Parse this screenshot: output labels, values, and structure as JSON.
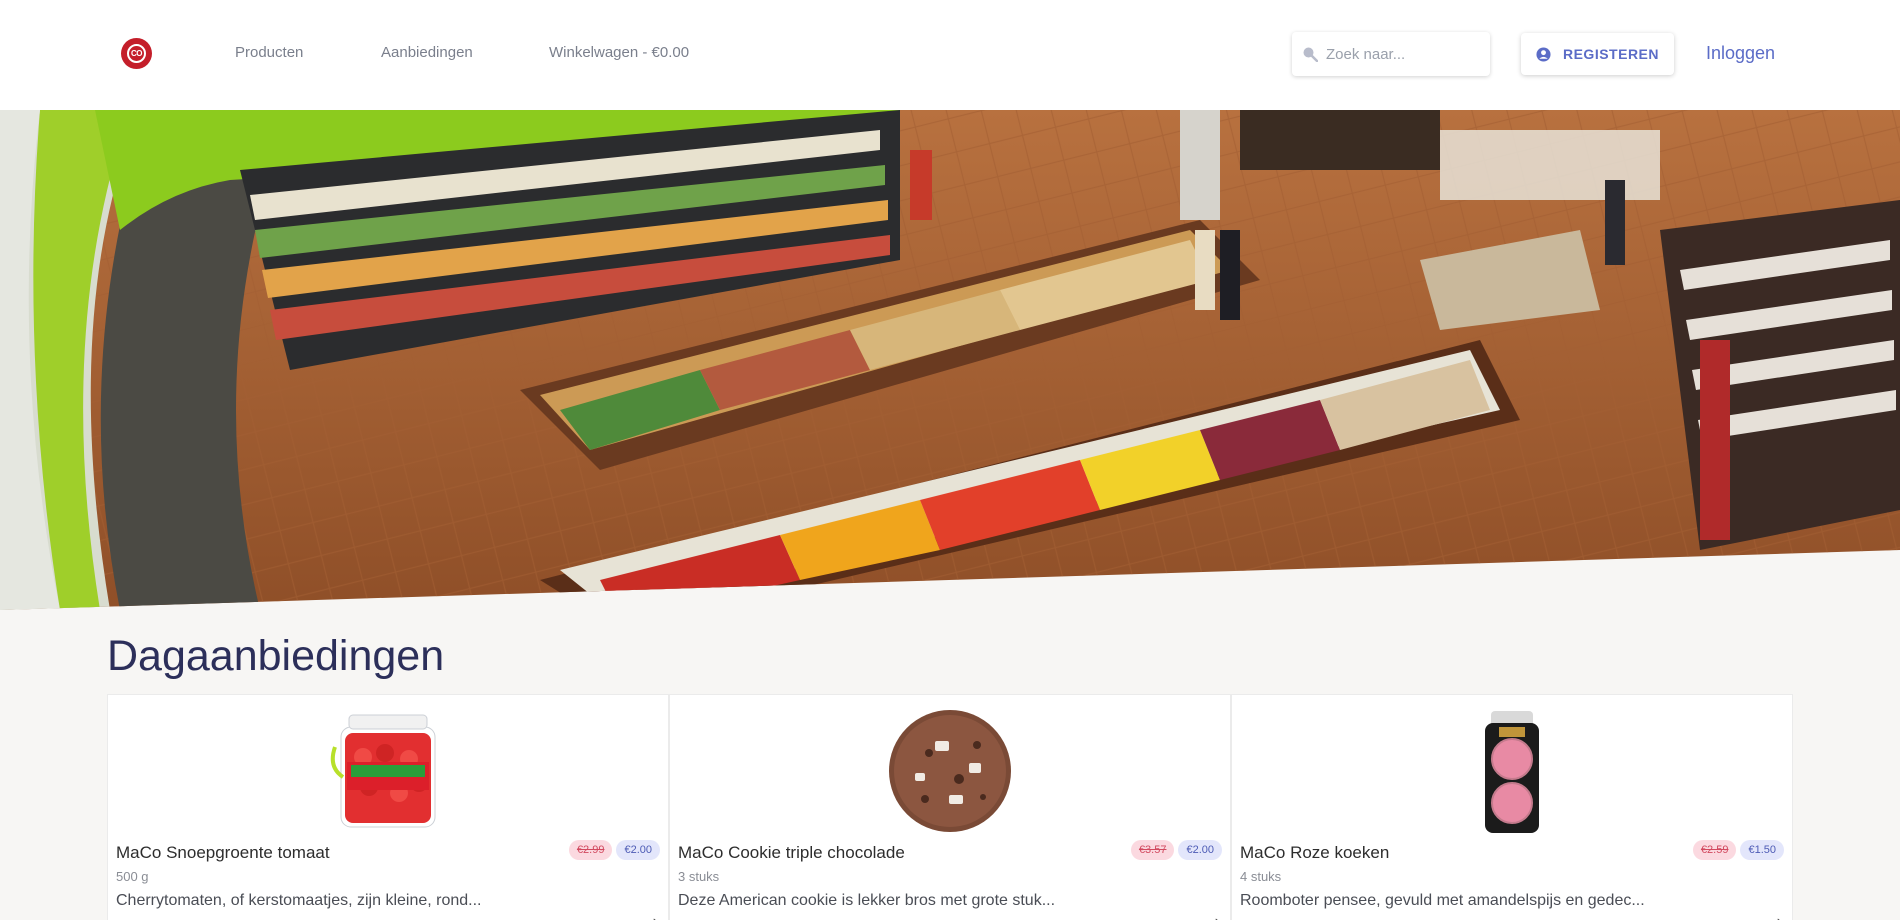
{
  "header": {
    "nav": {
      "producten": "Producten",
      "aanbiedingen": "Aanbiedingen",
      "winkelwagen": "Winkelwagen - €0.00"
    },
    "search": {
      "placeholder": "Zoek naar..."
    },
    "register_label": "REGISTEREN",
    "login_label": "Inloggen"
  },
  "section": {
    "title": "Dagaanbiedingen"
  },
  "products": [
    {
      "name": "MaCo Snoepgroente tomaat",
      "old_price": "€2.99",
      "new_price": "€2.00",
      "unit": "500 g",
      "description": "Cherrytomaten, of kerstomaatjes, zijn kleine, rond..."
    },
    {
      "name": "MaCo Cookie triple chocolade",
      "old_price": "€3.57",
      "new_price": "€2.00",
      "unit": "3 stuks",
      "description": "Deze American cookie is lekker bros met grote stuk..."
    },
    {
      "name": "MaCo Roze koeken",
      "old_price": "€2.59",
      "new_price": "€1.50",
      "unit": "4 stuks",
      "description": "Roomboter pensee, gevuld met amandelspijs en gedec..."
    }
  ],
  "colors": {
    "brand": "#c41e2a",
    "accent": "#5b6cc7",
    "title": "#2c2f5a"
  }
}
